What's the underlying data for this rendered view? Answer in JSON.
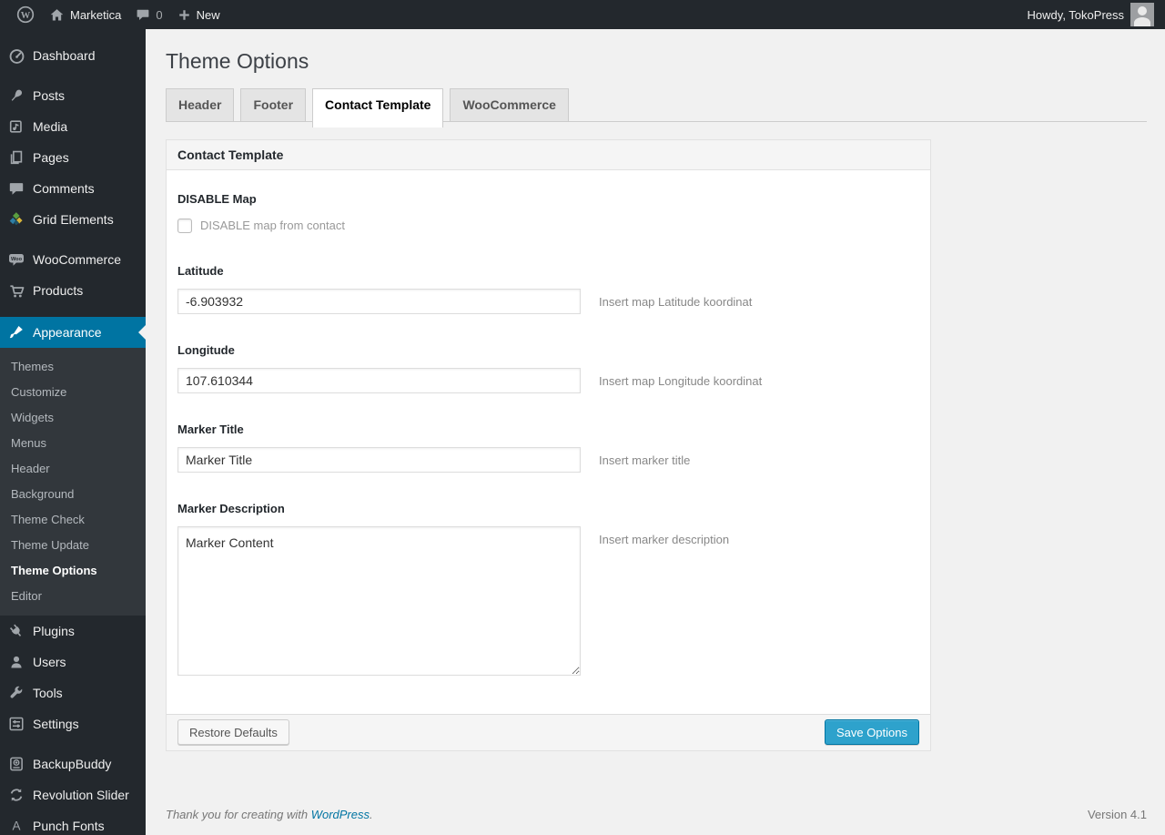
{
  "colors": {
    "accent": "#0074a2",
    "primary_button": "#2ea2cc",
    "sidebar_bg": "#23282d",
    "page_bg": "#f1f1f1"
  },
  "admin_bar": {
    "site_name": "Marketica",
    "comment_count": "0",
    "new_label": "New",
    "howdy": "Howdy, TokoPress"
  },
  "sidebar": {
    "items": [
      {
        "label": "Dashboard"
      },
      {
        "label": "Posts"
      },
      {
        "label": "Media"
      },
      {
        "label": "Pages"
      },
      {
        "label": "Comments"
      },
      {
        "label": "Grid Elements"
      },
      {
        "label": "WooCommerce"
      },
      {
        "label": "Products"
      },
      {
        "label": "Appearance"
      },
      {
        "label": "Plugins"
      },
      {
        "label": "Users"
      },
      {
        "label": "Tools"
      },
      {
        "label": "Settings"
      },
      {
        "label": "BackupBuddy"
      },
      {
        "label": "Revolution Slider"
      },
      {
        "label": "Punch Fonts"
      }
    ],
    "appearance_submenu": [
      {
        "label": "Themes"
      },
      {
        "label": "Customize"
      },
      {
        "label": "Widgets"
      },
      {
        "label": "Menus"
      },
      {
        "label": "Header"
      },
      {
        "label": "Background"
      },
      {
        "label": "Theme Check"
      },
      {
        "label": "Theme Update"
      },
      {
        "label": "Theme Options",
        "current": true
      },
      {
        "label": "Editor"
      }
    ]
  },
  "page": {
    "title": "Theme Options",
    "tabs": [
      {
        "label": "Header",
        "active": false
      },
      {
        "label": "Footer",
        "active": false
      },
      {
        "label": "Contact Template",
        "active": true
      },
      {
        "label": "WooCommerce",
        "active": false
      }
    ],
    "panel": {
      "title": "Contact Template",
      "fields": {
        "disable_map": {
          "label": "DISABLE Map",
          "checkbox_label": "DISABLE map from contact",
          "checked": false
        },
        "latitude": {
          "label": "Latitude",
          "value": "-6.903932",
          "hint": "Insert map Latitude koordinat"
        },
        "longitude": {
          "label": "Longitude",
          "value": "107.610344",
          "hint": "Insert map Longitude koordinat"
        },
        "marker_title": {
          "label": "Marker Title",
          "value": "Marker Title",
          "hint": "Insert marker title"
        },
        "marker_description": {
          "label": "Marker Description",
          "value": "Marker Content",
          "hint": "Insert marker description"
        }
      },
      "buttons": {
        "restore": "Restore Defaults",
        "save": "Save Options"
      }
    },
    "footer": {
      "thanks_prefix": "Thank you for creating with",
      "wordpress_link": "WordPress",
      "thanks_suffix": ".",
      "version": "Version 4.1"
    }
  }
}
